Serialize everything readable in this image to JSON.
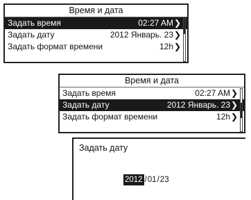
{
  "screen1": {
    "title": "Время и дата",
    "rows": [
      {
        "label": "Задать время",
        "value": "02:27 AM",
        "arrow": "❯",
        "selected": true
      },
      {
        "label": "Задать дату",
        "value": "2012 Январь. 23",
        "arrow": "❯",
        "selected": false
      },
      {
        "label": "Задать формат времени",
        "value": "12h",
        "arrow": "❯",
        "selected": false
      }
    ]
  },
  "screen2": {
    "title": "Время и дата",
    "rows": [
      {
        "label": "Задать время",
        "value": "02:27 AM",
        "arrow": "❯",
        "selected": false
      },
      {
        "label": "Задать дату",
        "value": "2012 Январь. 23",
        "arrow": "❯",
        "selected": true
      },
      {
        "label": "Задать формат времени",
        "value": "12h",
        "arrow": "❯",
        "selected": false
      }
    ]
  },
  "screen3": {
    "title": "Задать дату",
    "date": {
      "year": "2012",
      "month": "01",
      "day": "23",
      "separator": "/"
    }
  }
}
